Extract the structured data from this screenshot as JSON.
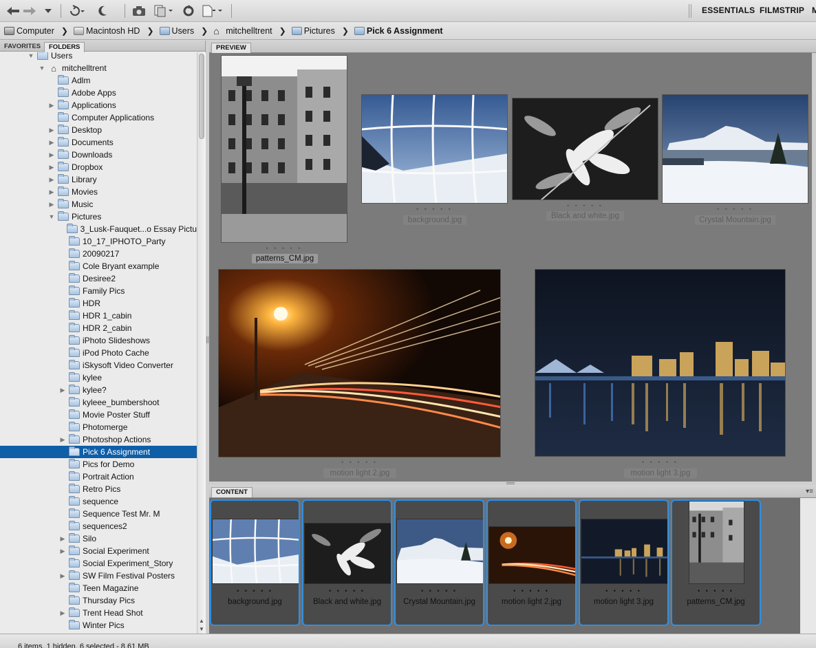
{
  "toolbar": {
    "workspaces": [
      "ESSENTIALS",
      "FILMSTRIP",
      "M"
    ],
    "icons": [
      "back-arrow-icon",
      "forward-arrow-icon",
      "dropdown-icon",
      "rotate-icon",
      "moon-icon",
      "camera-icon",
      "copy-icon",
      "refresh-icon",
      "new-document-icon"
    ]
  },
  "pathbar": {
    "crumbs": [
      "Computer",
      "Macintosh HD",
      "Users",
      "mitchelltrent",
      "Pictures",
      "Pick 6 Assignment"
    ]
  },
  "left_panel": {
    "tabs": [
      "FAVORITES",
      "FOLDERS"
    ],
    "active_tab": "FOLDERS",
    "tree": [
      {
        "label": "Users",
        "level": 0,
        "expanded": true,
        "has_children": true
      },
      {
        "label": "mitchelltrent",
        "level": 1,
        "expanded": true,
        "has_children": true,
        "icon": "home-icon"
      },
      {
        "label": "Adlm",
        "level": 2,
        "has_children": false
      },
      {
        "label": "Adobe Apps",
        "level": 2,
        "has_children": false
      },
      {
        "label": "Applications",
        "level": 2,
        "has_children": true
      },
      {
        "label": "Computer Applications",
        "level": 2,
        "has_children": false
      },
      {
        "label": "Desktop",
        "level": 2,
        "has_children": true
      },
      {
        "label": "Documents",
        "level": 2,
        "has_children": true
      },
      {
        "label": "Downloads",
        "level": 2,
        "has_children": true
      },
      {
        "label": "Dropbox",
        "level": 2,
        "has_children": true
      },
      {
        "label": "Library",
        "level": 2,
        "has_children": true
      },
      {
        "label": "Movies",
        "level": 2,
        "has_children": true
      },
      {
        "label": "Music",
        "level": 2,
        "has_children": true
      },
      {
        "label": "Pictures",
        "level": 2,
        "expanded": true,
        "has_children": true
      },
      {
        "label": "3_Lusk-Fauquet...o Essay Pictu",
        "level": 3,
        "has_children": false
      },
      {
        "label": "10_17_IPHOTO_Party",
        "level": 3,
        "has_children": false
      },
      {
        "label": "20090217",
        "level": 3,
        "has_children": false
      },
      {
        "label": "Cole Bryant example",
        "level": 3,
        "has_children": false
      },
      {
        "label": "Desiree2",
        "level": 3,
        "has_children": false
      },
      {
        "label": "Family Pics",
        "level": 3,
        "has_children": false
      },
      {
        "label": "HDR",
        "level": 3,
        "has_children": false
      },
      {
        "label": "HDR 1_cabin",
        "level": 3,
        "has_children": false
      },
      {
        "label": "HDR 2_cabin",
        "level": 3,
        "has_children": false
      },
      {
        "label": "iPhoto Slideshows",
        "level": 3,
        "has_children": false
      },
      {
        "label": "iPod Photo Cache",
        "level": 3,
        "has_children": false
      },
      {
        "label": "iSkysoft Video Converter",
        "level": 3,
        "has_children": false
      },
      {
        "label": "kylee",
        "level": 3,
        "has_children": false
      },
      {
        "label": "kylee?",
        "level": 3,
        "has_children": true
      },
      {
        "label": "kyleee_bumbershoot",
        "level": 3,
        "has_children": false
      },
      {
        "label": "Movie Poster Stuff",
        "level": 3,
        "has_children": false
      },
      {
        "label": "Photomerge",
        "level": 3,
        "has_children": false
      },
      {
        "label": "Photoshop Actions",
        "level": 3,
        "has_children": true
      },
      {
        "label": "Pick 6 Assignment",
        "level": 3,
        "has_children": false,
        "selected": true
      },
      {
        "label": "Pics for Demo",
        "level": 3,
        "has_children": false
      },
      {
        "label": "Portrait Action",
        "level": 3,
        "has_children": false
      },
      {
        "label": "Retro Pics",
        "level": 3,
        "has_children": false
      },
      {
        "label": "sequence",
        "level": 3,
        "has_children": false
      },
      {
        "label": "Sequence Test Mr. M",
        "level": 3,
        "has_children": false
      },
      {
        "label": "sequences2",
        "level": 3,
        "has_children": false
      },
      {
        "label": "Silo",
        "level": 3,
        "has_children": true
      },
      {
        "label": "Social Experiment",
        "level": 3,
        "has_children": true
      },
      {
        "label": "Social Experiment_Story",
        "level": 3,
        "has_children": false
      },
      {
        "label": "SW Film Festival Posters",
        "level": 3,
        "has_children": true
      },
      {
        "label": "Teen Magazine",
        "level": 3,
        "has_children": false
      },
      {
        "label": "Thursday Pics",
        "level": 3,
        "has_children": false
      },
      {
        "label": "Trent Head Shot",
        "level": 3,
        "has_children": true
      },
      {
        "label": "Winter Pics",
        "level": 3,
        "has_children": false
      }
    ]
  },
  "preview": {
    "tab": "PREVIEW",
    "items": [
      {
        "name": "patterns_CM.jpg",
        "stars": "• • • • •",
        "focused": true
      },
      {
        "name": "background.jpg",
        "stars": "• • • • •"
      },
      {
        "name": "Black and white.jpg",
        "stars": "• • • • •"
      },
      {
        "name": "Crystal Mountain.jpg",
        "stars": "• • • • •"
      },
      {
        "name": "motion light 2.jpg",
        "stars": "• • • • •"
      },
      {
        "name": "motion light 3.jpg",
        "stars": "• • • • •"
      }
    ]
  },
  "content": {
    "tab": "CONTENT",
    "items": [
      {
        "name": "background.jpg",
        "stars": "• • • • •"
      },
      {
        "name": "Black and white.jpg",
        "stars": "• • • • •"
      },
      {
        "name": "Crystal Mountain.jpg",
        "stars": "• • • • •"
      },
      {
        "name": "motion light 2.jpg",
        "stars": "• • • • •"
      },
      {
        "name": "motion light 3.jpg",
        "stars": "• • • • •"
      },
      {
        "name": "patterns_CM.jpg",
        "stars": "• • • • •"
      }
    ]
  },
  "status": {
    "text": "6 items, 1 hidden, 6 selected - 8.61 MB"
  },
  "colors": {
    "selection": "#0e5ea8",
    "card_border": "#2f8fe6",
    "preview_bg": "#7b7b7b"
  }
}
